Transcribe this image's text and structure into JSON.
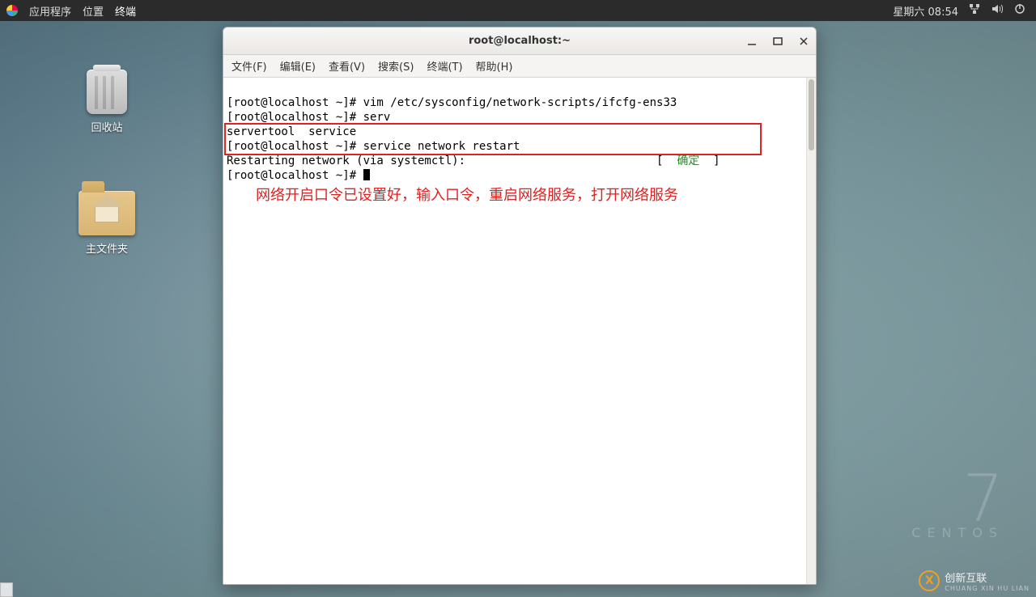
{
  "panel": {
    "menus": {
      "apps": "应用程序",
      "places": "位置",
      "terminal": "终端"
    },
    "clock": "星期六 08:54"
  },
  "desktop": {
    "trash_label": "回收站",
    "home_label": "主文件夹"
  },
  "brand": {
    "version": "7",
    "name": "CENTOS"
  },
  "watermark": {
    "text": "创新互联",
    "sub": "CHUANG XIN HU LIAN"
  },
  "window": {
    "title": "root@localhost:~",
    "menus": {
      "file": "文件(F)",
      "edit": "编辑(E)",
      "view": "查看(V)",
      "search": "搜索(S)",
      "terminal": "终端(T)",
      "help": "帮助(H)"
    },
    "terminal": {
      "line1": "[root@localhost ~]# vim /etc/sysconfig/network-scripts/ifcfg-ens33",
      "line2": "[root@localhost ~]# serv",
      "line3": "servertool  service",
      "line4": "[root@localhost ~]# service network restart",
      "line5a": "Restarting network (via systemctl):  ",
      "line5b": "                          [  ",
      "line5_status": "确定",
      "line5c": "  ]",
      "line6": "[root@localhost ~]# "
    },
    "annotation": "网络开启口令已设置好，输入口令，重启网络服务，打开网络服务"
  }
}
